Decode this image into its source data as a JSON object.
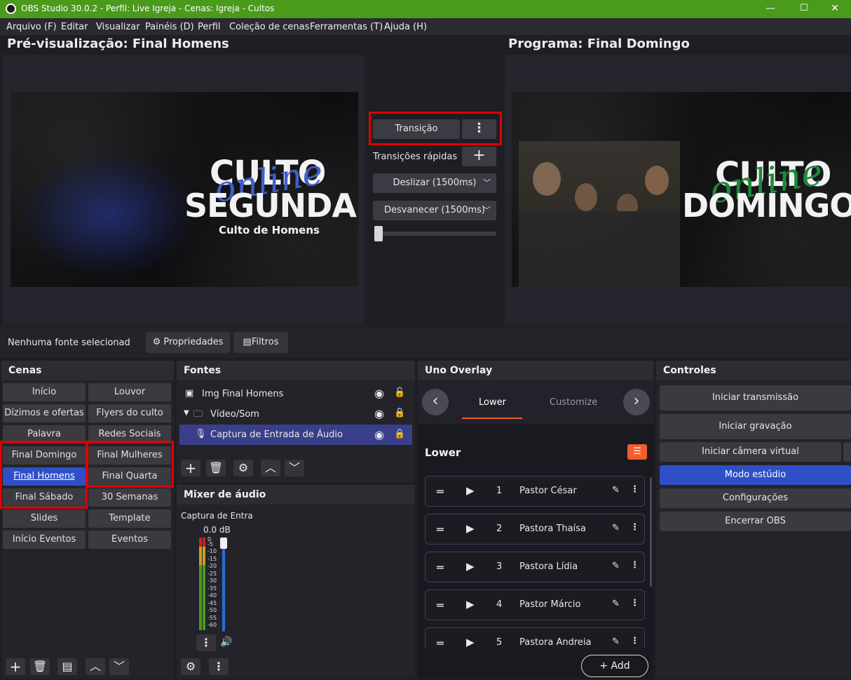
{
  "window": {
    "title": "OBS Studio 30.0.2 - Perfil: Live Igreja - Cenas: Igreja - Cultos",
    "minimize": "—",
    "maximize": "☐",
    "close": "✕"
  },
  "menu": [
    "Arquivo (F)",
    "Editar",
    "Visualizar",
    "Painéis (D)",
    "Perfil",
    "Coleção de cenas",
    "Ferramentas (T)",
    "Ajuda (H)"
  ],
  "preview": {
    "heading": "Pré-visualização: Final Homens",
    "line1": "CULTO",
    "script": "online",
    "line2": "SEGUNDA",
    "sub": "Culto de Homens"
  },
  "program": {
    "heading": "Programa: Final Domingo",
    "line1": "CULTO",
    "script": "online",
    "line2": "DOMINGO"
  },
  "transitions": {
    "button": "Transição",
    "quick_label": "Transições rápidas",
    "quick_1": "Deslizar (1500ms)",
    "quick_2": "Desvanecer (1500ms)",
    "tbar_level": 0.0
  },
  "source_bar": {
    "status": "Nenhuma fonte selecionad",
    "properties": "Propriedades",
    "filters": "Filtros"
  },
  "scenes": {
    "title": "Cenas",
    "items": [
      "Início",
      "Louvor",
      "Dízimos e ofertas",
      "Flyers do culto",
      "Palavra",
      "Redes Sociais",
      "Final Domingo",
      "Final Mulheres",
      "Final Homens",
      "Final Quarta",
      "Final Sábado",
      "30 Semanas",
      "Slides",
      "Template",
      "Início Eventos",
      "Eventos"
    ],
    "selected": "Final Homens"
  },
  "sources": {
    "title": "Fontes",
    "items": [
      {
        "name": "Img Final Homens",
        "icon": "image-icon"
      },
      {
        "name": "Vídeo/Som",
        "icon": "folder-icon"
      },
      {
        "name": "Captura de Entrada de Áudio",
        "icon": "microphone-icon"
      }
    ]
  },
  "mixer": {
    "title": "Mixer de áudio",
    "channel": "Captura de Entra",
    "level": "0.0 dB",
    "ticks": [
      "0",
      "-5",
      "-10",
      "-15",
      "-20",
      "-25",
      "-30",
      "-35",
      "-40",
      "-45",
      "-50",
      "-55",
      "-60"
    ]
  },
  "uno": {
    "title": "Uno Overlay",
    "tab_active": "Lower",
    "tab_other": "Customize",
    "section": "Lower",
    "rows": [
      {
        "num": "1",
        "name": "Pastor César"
      },
      {
        "num": "2",
        "name": "Pastora Thaísa"
      },
      {
        "num": "3",
        "name": "Pastora Lídia"
      },
      {
        "num": "4",
        "name": "Pastor Márcio"
      },
      {
        "num": "5",
        "name": "Pastora Andreia"
      }
    ],
    "add": "+ Add"
  },
  "controls": {
    "title": "Controles",
    "stream": "Iniciar transmissão",
    "record": "Iniciar gravação",
    "virtualcam": "Iniciar câmera virtual",
    "studio": "Modo estúdio",
    "settings": "Configurações",
    "exit": "Encerrar OBS"
  },
  "colors": {
    "titlebar": "#4a9a1c",
    "accent": "#2e4fc7",
    "highlight": "#e00000",
    "uno_accent": "#f25c2c"
  }
}
